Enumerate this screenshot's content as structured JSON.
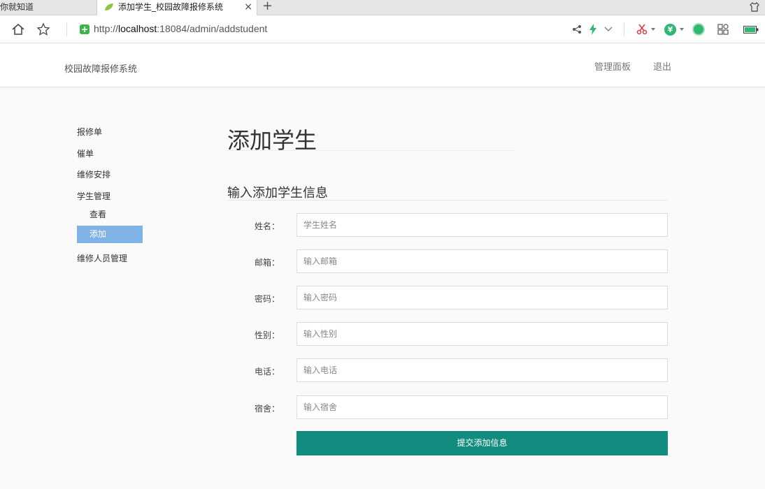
{
  "browser": {
    "tabs": [
      {
        "label": "你就知道",
        "active": false
      },
      {
        "label": "添加学生_校园故障报修系统",
        "active": true
      }
    ],
    "tab_close": "×",
    "new_tab": "+",
    "url_prefix": "http://",
    "url_host": "localhost",
    "url_rest": ":18084/admin/addstudent"
  },
  "header": {
    "brand": "校园故障报修系统",
    "nav": [
      {
        "label": "管理面板"
      },
      {
        "label": "退出"
      }
    ]
  },
  "sidebar": {
    "items": [
      {
        "label": "报修单"
      },
      {
        "label": "催单"
      },
      {
        "label": "维修安排"
      },
      {
        "label": "学生管理"
      },
      {
        "label": "查看"
      },
      {
        "label": "添加",
        "active": true
      },
      {
        "label": "维修人员管理"
      }
    ]
  },
  "main": {
    "title": "添加学生",
    "section_title": "输入添加学生信息",
    "fields": [
      {
        "label": "姓名：",
        "placeholder": "学生姓名"
      },
      {
        "label": "邮箱：",
        "placeholder": "输入邮箱"
      },
      {
        "label": "密码：",
        "placeholder": "输入密码"
      },
      {
        "label": "性别：",
        "placeholder": "输入性别"
      },
      {
        "label": "电话：",
        "placeholder": "输入电话"
      },
      {
        "label": "宿舍：",
        "placeholder": "输入宿舍"
      }
    ],
    "submit_label": "提交添加信息"
  },
  "colors": {
    "submit_bg": "#128c7e",
    "sidebar_active_bg": "#7fb3e5"
  },
  "icons": [
    "home-icon",
    "star-icon",
    "secure-icon",
    "share-icon",
    "lightning-icon",
    "chevron-down-icon",
    "scissors-icon",
    "yen-icon",
    "wechat-icon",
    "apps-icon",
    "battery-icon",
    "shirt-icon",
    "leaf-icon"
  ]
}
